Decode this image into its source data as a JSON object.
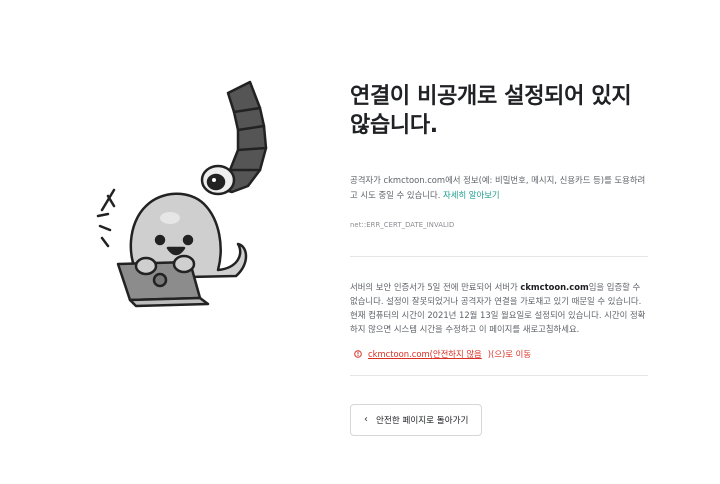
{
  "error": {
    "title_line1": "연결이 비공개로 설정되어 있지",
    "title_line2": "않습니다.",
    "description": "공격자가 ckmctoon.com에서 정보(예: 비밀번호, 메시지, 신용카드 등)를 도용하려고 시도 중일 수 있습니다. ",
    "learn_more_label": "자세히 알아보기",
    "error_code": "net::ERR_CERT_DATE_INVALID"
  },
  "details": {
    "text_part1": "서버의 보안 인증서가 5일 전에 만료되어 서버가 ",
    "domain": "ckmctoon.com",
    "text_part2": "임을 입증할 수 없습니다. 설정이 잘못되었거나 공격자가 연결을 가로채고 있기 때문일 수 있습니다. 현재 컴퓨터의 시간이 2021년 12월 13일 월요일로 설정되어 있습니다. 시간이 정확하지 않으면 시스템 시간을 수정하고 이 페이지를 새로고침하세요.",
    "proceed_prefix": "ckmctoon.com(",
    "proceed_unsafe": "안전하지 않음",
    "proceed_suffix": ")(으)로 이동"
  },
  "actions": {
    "back_label": "안전한 페이지로 돌아가기",
    "back_icon": "chevron-left-icon"
  },
  "colors": {
    "link": "#1a9c8c",
    "warning": "#d93025",
    "title": "#202124",
    "body": "#5f6368"
  }
}
